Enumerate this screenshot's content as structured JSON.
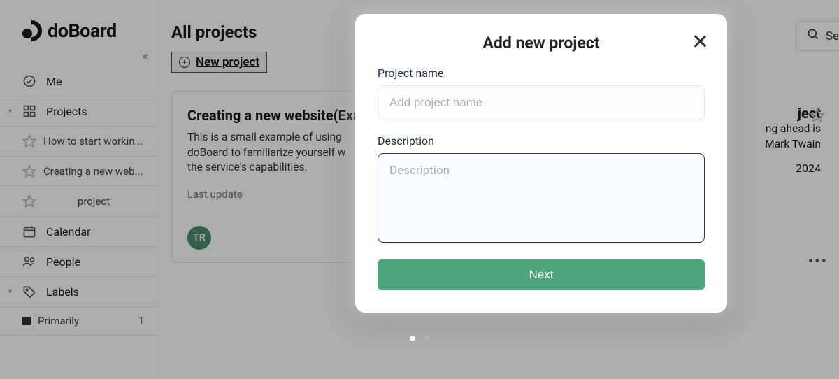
{
  "brand": {
    "name": "doBoard"
  },
  "sidebar": {
    "items": [
      {
        "label": "Me"
      },
      {
        "label": "Projects"
      },
      {
        "label": "How to start workin..."
      },
      {
        "label": "Creating a new web..."
      },
      {
        "label": "project"
      },
      {
        "label": "Calendar"
      },
      {
        "label": "People"
      },
      {
        "label": "Labels"
      },
      {
        "label": "Primarily",
        "count": "1"
      }
    ]
  },
  "header": {
    "title": "All projects",
    "new_project_label": "New project",
    "search_fragment": "Se"
  },
  "cards": {
    "left": {
      "title": "Creating a new website(Example)",
      "desc_line1": "This is a small example of using",
      "desc_line2": "doBoard to familiarize yourself w",
      "desc_line3": "the service's capabilities.",
      "meta": "Last update",
      "avatar": "TR"
    },
    "right": {
      "title_frag": "ject",
      "line1": "ng ahead is",
      "line2": "Mark Twain",
      "date": "2024"
    }
  },
  "modal": {
    "title": "Add new project",
    "project_name_label": "Project name",
    "project_name_placeholder": "Add project name",
    "description_label": "Description",
    "description_placeholder": "Description",
    "next_label": "Next"
  }
}
